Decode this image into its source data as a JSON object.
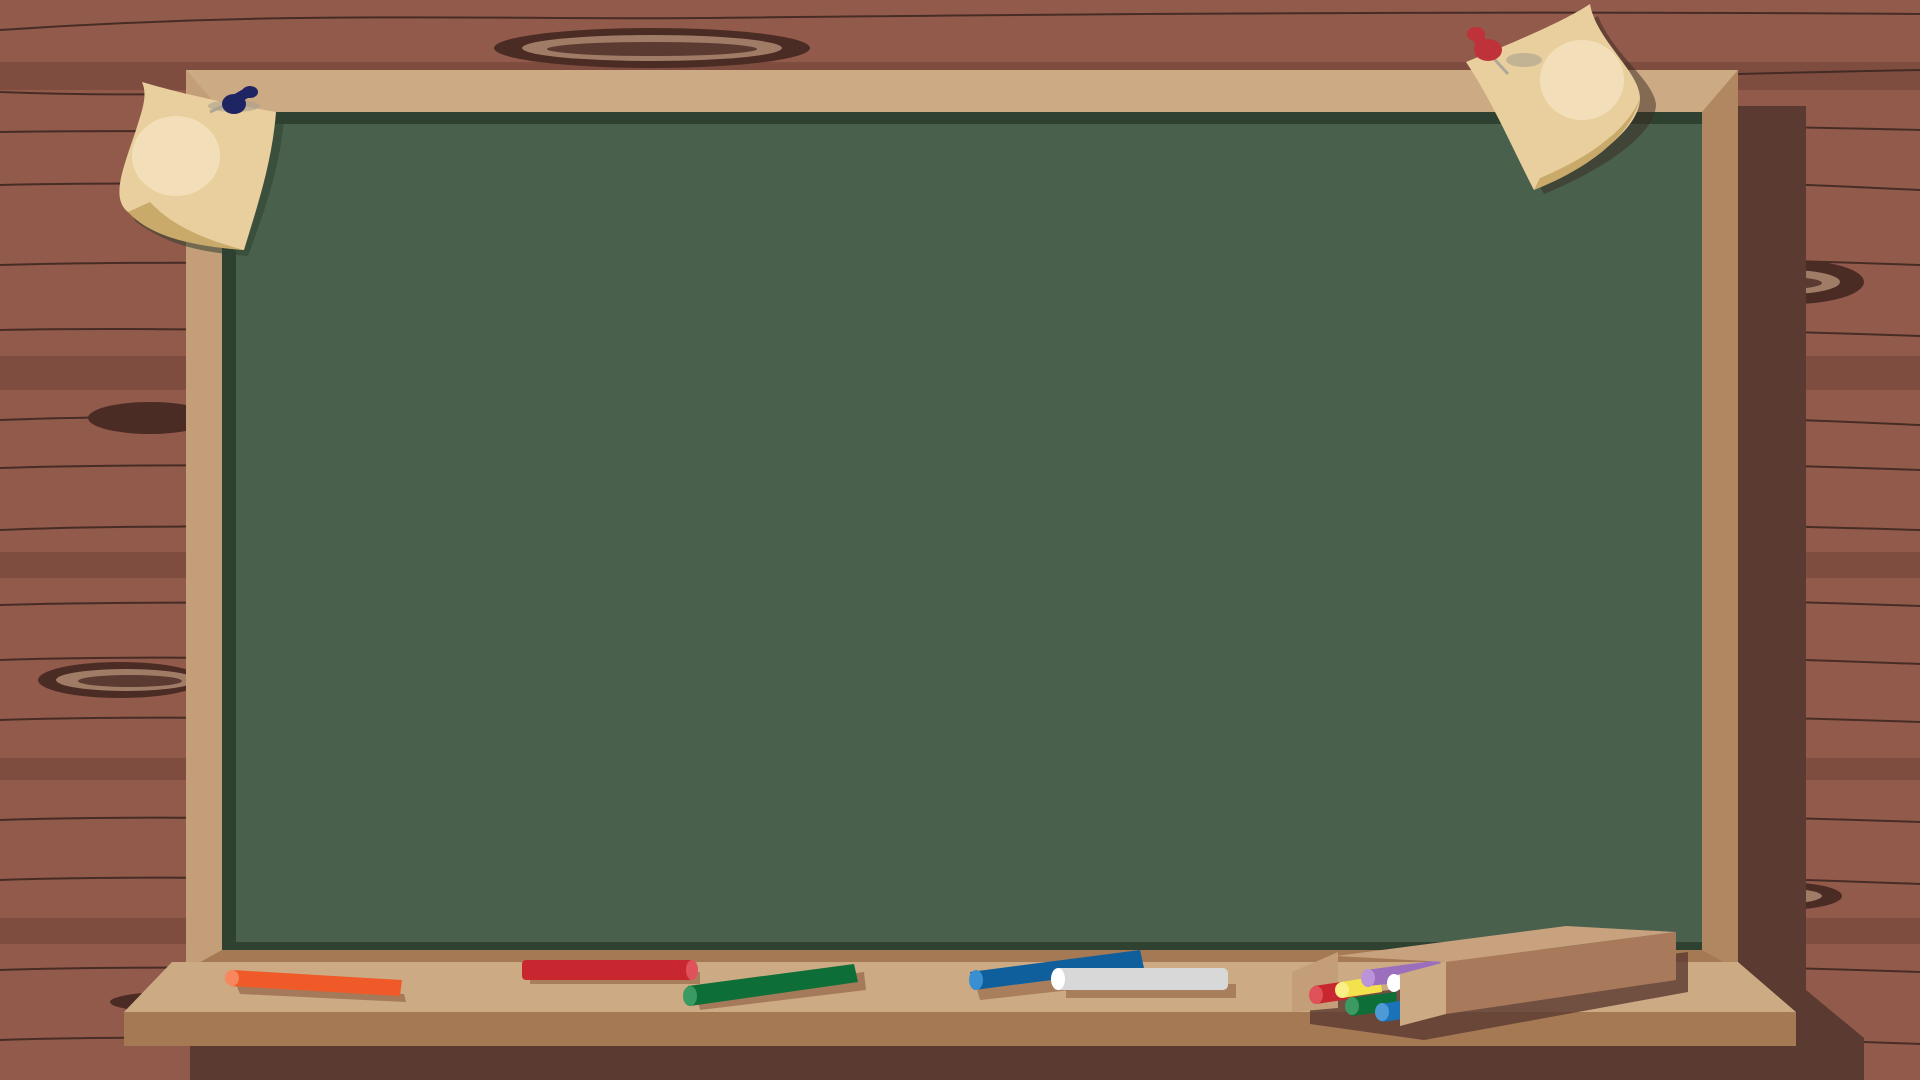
{
  "scene": {
    "description_label": "",
    "colors": {
      "wall": "#925a4b",
      "wall_grain": "#3b2520",
      "wall_shadow": "#5a3a31",
      "frame_light": "#ccaa84",
      "frame_mid": "#be9670",
      "frame_dark": "#a47953",
      "board": "#49604d",
      "board_edge": "#2f4232",
      "paper": "#e8cf9d",
      "paper_shade": "#c9aa6a",
      "pin_navy": "#1f2463",
      "pin_red": "#c0323a"
    },
    "chalk_colors": [
      "#f05a28",
      "#c8272f",
      "#0e6e37",
      "#0f5f9c",
      "#d8d8d8"
    ],
    "box_chalk_colors": [
      "#c8272f",
      "#f3e24b",
      "#0e6e37",
      "#9c6fbe",
      "#1a72b9",
      "#e8e8e8"
    ]
  }
}
